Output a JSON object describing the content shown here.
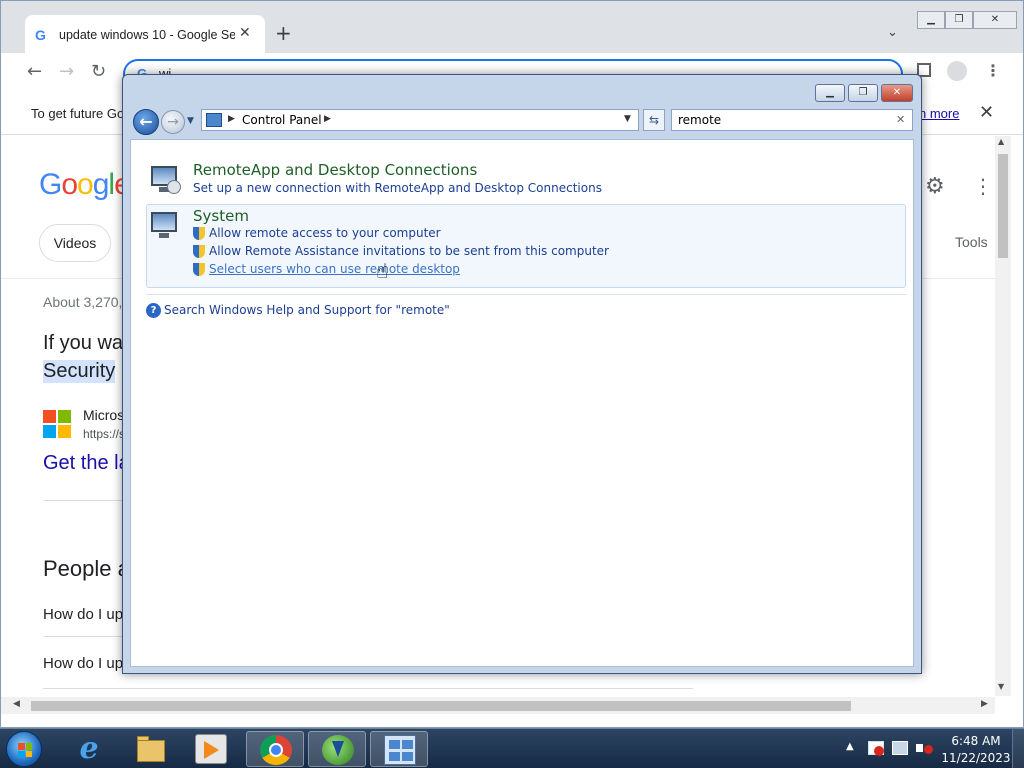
{
  "chrome": {
    "tab_title": "update windows 10 - Google Sea",
    "tab_favicon": "G",
    "omnibox_favicon": "G",
    "omnibox_text": "wi",
    "infobar_message": "To get future Go",
    "infobar_learn_more": "n more",
    "colors": {
      "accent": "#1a73e8",
      "link": "#1a0dab"
    }
  },
  "google": {
    "logo_text": "Google",
    "videos_chip": "Videos",
    "tools_link": "Tools",
    "about_results": "About 3,270,",
    "snippet_line1": "If you wa",
    "snippet_line2": "Security",
    "source_name": "Micros",
    "source_url": "https://s",
    "result_link": "Get the la",
    "people_also_ask": "People a",
    "questions": [
      "How do I up",
      "How do I up"
    ],
    "icons": {
      "settings": "gear-icon",
      "apps": "apps-grid-icon"
    }
  },
  "control_panel": {
    "breadcrumb": "Control Panel",
    "search_value": "remote",
    "groups": [
      {
        "title": "RemoteApp and Desktop Connections",
        "links": [
          "Set up a new connection with RemoteApp and Desktop Connections"
        ]
      },
      {
        "title": "System",
        "links": [
          "Allow remote access to your computer",
          "Allow Remote Assistance invitations to be sent from this computer",
          "Select users who can use remote desktop"
        ]
      }
    ],
    "help_link": "Search Windows Help and Support for \"remote\"",
    "colors": {
      "heading": "#1e5f28",
      "link": "#1c3f94",
      "frame": "#c5d6ea"
    }
  },
  "taskbar": {
    "apps": [
      "internet-explorer",
      "windows-explorer",
      "windows-media-player",
      "google-chrome",
      "internet-download-manager",
      "control-panel"
    ],
    "active_app": "control-panel",
    "clock_time": "6:48 AM",
    "clock_date": "11/22/2023"
  }
}
